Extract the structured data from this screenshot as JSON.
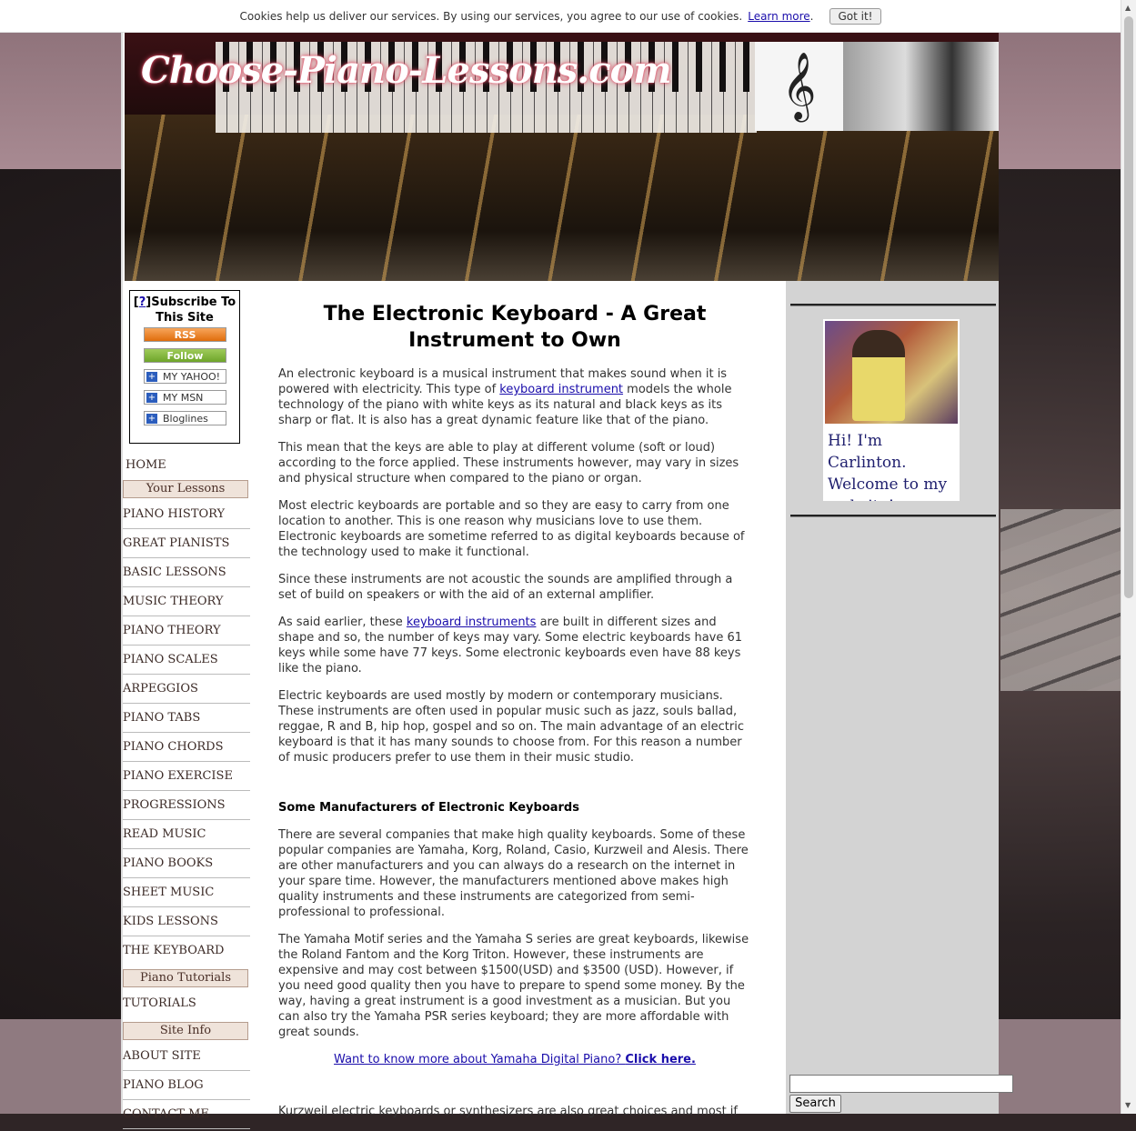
{
  "cookie_bar": {
    "message": "Cookies help us deliver our services. By using our services, you agree to our use of cookies.",
    "learn_more": "Learn more",
    "dot": ".",
    "got_it": "Got it!"
  },
  "header": {
    "logo": "Choose-Piano-Lessons.com",
    "clef": "𝄞"
  },
  "subscribe": {
    "q": "?",
    "title": "Subscribe To This Site",
    "rss": "RSS",
    "follow": "Follow",
    "yahoo": "MY YAHOO!",
    "msn": "MY MSN",
    "bloglines": "Bloglines"
  },
  "nav": {
    "home": "HOME",
    "your_lessons_heading": "Your Lessons",
    "lessons": [
      "PIANO HISTORY",
      "GREAT PIANISTS",
      "BASIC LESSONS",
      "MUSIC THEORY",
      "PIANO THEORY",
      "PIANO SCALES",
      "ARPEGGIOS",
      "PIANO TABS",
      "PIANO CHORDS",
      "PIANO EXERCISE",
      "PROGRESSIONS",
      "READ MUSIC",
      "PIANO BOOKS",
      "SHEET MUSIC",
      "KIDS LESSONS",
      "THE KEYBOARD"
    ],
    "tutorials_heading": "Piano Tutorials",
    "tutorials": "TUTORIALS",
    "site_info_heading": "Site Info",
    "site_info": [
      "ABOUT SITE",
      "PIANO BLOG",
      "CONTACT ME"
    ]
  },
  "article": {
    "title": "The Electronic Keyboard - A Great Instrument to Own",
    "p1_a": "An electronic keyboard is a musical instrument that makes sound when it is powered with electricity. This type of ",
    "p1_link": "keyboard instrument",
    "p1_b": " models the whole technology of the piano with white keys as its natural and black keys as its sharp or flat. It is also has a great dynamic feature like that of the piano.",
    "p2": "This mean that the keys are able to play at different volume (soft or loud) according to the force applied. These instruments however, may vary in sizes and physical structure when compared to the piano or organ.",
    "p3": "Most electric keyboards are portable and so they are easy to carry from one location to another. This is one reason why musicians love to use them. Electronic keyboards are sometime referred to as digital keyboards because of the technology used to make it functional.",
    "p4": "Since these instruments are not acoustic the sounds are amplified through a set of build on speakers or with the aid of an external amplifier.",
    "p5_a": "As said earlier, these ",
    "p5_link": "keyboard instruments",
    "p5_b": " are built in different sizes and shape and so, the number of keys may vary. Some electric keyboards have 61 keys while some have 77 keys. Some electronic keyboards even have 88 keys like the piano.",
    "p6": "Electric keyboards are used mostly by modern or contemporary musicians. These instruments are often used in popular music such as jazz, souls ballad, reggae, R and B, hip hop, gospel and so on. The main advantage of an electric keyboard is that it has many sounds to choose from. For this reason a number of music producers prefer to use them in their music studio.",
    "h2": "Some Manufacturers of Electronic Keyboards",
    "p7": "There are several companies that make high quality keyboards. Some of these popular companies are Yamaha, Korg, Roland, Casio, Kurzweil and Alesis. There are other manufacturers and you can always do a research on the internet in your spare time. However, the manufacturers mentioned above makes high quality instruments and these instruments are categorized from semi-professional to professional.",
    "p8": "The Yamaha Motif series and the Yamaha S series are great keyboards, likewise the Roland Fantom and the Korg Triton. However, these instruments are expensive and may cost between $1500(USD) and $3500 (USD). However, if you need good quality then you have to prepare to spend some money. By the way, having a great instrument is a good investment as a musician. But you can also try the Yamaha PSR series keyboard; they are more affordable with great sounds.",
    "cta_a": "Want to know more about Yamaha Digital Piano? ",
    "cta_b": "Click here.",
    "p9_partial": "Kurzweil electric keyboards or synthesizers are also great choices and most if"
  },
  "sidebar": {
    "caption": "Hi! I'm Carlinton. Welcome to my website!",
    "search_button": "Search",
    "search_value": ""
  }
}
